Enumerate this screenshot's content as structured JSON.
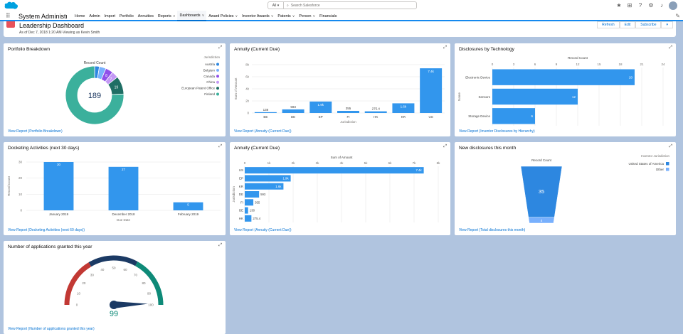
{
  "global": {
    "search_scope": "All",
    "search_placeholder": "Search Salesforce",
    "app_name": "System Administra...",
    "nav": [
      {
        "label": "Home",
        "menu": false,
        "active": false
      },
      {
        "label": "Admin",
        "menu": false,
        "active": false
      },
      {
        "label": "Import",
        "menu": false,
        "active": false
      },
      {
        "label": "Portfolio",
        "menu": false,
        "active": false
      },
      {
        "label": "Annuities",
        "menu": false,
        "active": false
      },
      {
        "label": "Reports",
        "menu": true,
        "active": false
      },
      {
        "label": "Dashboards",
        "menu": true,
        "active": true
      },
      {
        "label": "Award Policies",
        "menu": true,
        "active": false
      },
      {
        "label": "Inventor Awards",
        "menu": true,
        "active": false
      },
      {
        "label": "Patents",
        "menu": true,
        "active": false
      },
      {
        "label": "Person",
        "menu": true,
        "active": false
      },
      {
        "label": "Financials",
        "menu": false,
        "active": false
      }
    ]
  },
  "header": {
    "title": "Leadership Dashboard",
    "subtitle": "As of Dec 7, 2018 1:20 AM·Viewing as Kevin Smith",
    "buttons": [
      "Refresh",
      "Edit",
      "Subscribe"
    ]
  },
  "colors": {
    "blue": "#3296ed",
    "teal": "#2eaaa0",
    "purple": "#c398f5",
    "dark_purple": "#9050e9",
    "light_blue": "#78b0fd",
    "green_teal": "#3bb09c",
    "gauge_red": "#c23934",
    "gauge_navy": "#1b3a64",
    "gauge_teal": "#0e8a78"
  },
  "widgets": {
    "portfolio": {
      "title": "Portfolio Breakdown",
      "link": "View Report (Portfolio Breakdown)",
      "center_value": "189"
    },
    "annuity_col": {
      "title": "Annuity (Current Due)",
      "link": "View Report (Annuity (Current Due))"
    },
    "disclosures_tech": {
      "title": "Disclosures by Technology",
      "link": "View Report (Inventor Disclosures by Hierarchy)"
    },
    "docketing": {
      "title": "Docketing Activities (next 30 days)",
      "link": "View Report (Docketing Activities (next 60 days))"
    },
    "annuity_bar": {
      "title": "Annuity (Current Due)",
      "link": "View Report (Annuity (Current Due))"
    },
    "new_disclosures": {
      "title": "New disclosures this month",
      "link": "View Report (Total disclosures this month)"
    },
    "applications": {
      "title": "Number of applications granted this year",
      "link": "View Report (Number of applications granted this year)"
    }
  },
  "chart_data": [
    {
      "type": "pie",
      "id": "portfolio",
      "title": "Record Count",
      "legend_title": "Jurisdiction",
      "legend_position": "right",
      "center_value": 189,
      "categories": [
        "Austria",
        "Belgium",
        "Canada",
        "China",
        "European Patent Office",
        "Finland"
      ],
      "colors": [
        "#2d87e0",
        "#78b0fd",
        "#9050e9",
        "#c398f5",
        "#1f6e64",
        "#3bb09c"
      ],
      "values": [
        5,
        7,
        8,
        7,
        19,
        143
      ],
      "data_labels": [
        "",
        "",
        "8",
        "7",
        "19",
        ""
      ]
    },
    {
      "type": "bar",
      "id": "annuity_col",
      "xlabel": "Jurisdiction",
      "ylabel": "Sum of Amount",
      "categories": [
        "BE",
        "DE",
        "EP",
        "FI",
        "HK",
        "KR",
        "US"
      ],
      "values": [
        138,
        593,
        1900,
        355,
        275.4,
        1600,
        7400
      ],
      "data_labels": [
        "138",
        "593",
        "1.9k",
        "355",
        "275.4",
        "1.6k",
        "7.4k"
      ],
      "ylim": [
        0,
        8000
      ],
      "yticks": [
        0,
        2000,
        4000,
        6000,
        8000
      ],
      "ytick_labels": [
        "0",
        "2k",
        "4k",
        "6k",
        "8k"
      ]
    },
    {
      "type": "bar",
      "id": "disclosures_tech",
      "orientation": "horizontal",
      "title": "Record Count",
      "ylabel": "Name",
      "categories": [
        "Electronic Device",
        "Sensors",
        "Storage Device"
      ],
      "values": [
        20,
        12,
        6
      ],
      "xlim": [
        0,
        24
      ],
      "xticks": [
        0,
        3,
        6,
        9,
        12,
        15,
        18,
        21,
        24
      ]
    },
    {
      "type": "bar",
      "id": "docketing",
      "xlabel": "Due Date",
      "ylabel": "Record Count",
      "categories": [
        "January 2019",
        "December 2018",
        "February 2019"
      ],
      "values": [
        30,
        27,
        5
      ],
      "ylim": [
        0,
        30
      ],
      "yticks": [
        0,
        10,
        20,
        30
      ]
    },
    {
      "type": "bar",
      "id": "annuity_bar",
      "orientation": "horizontal",
      "title": "Sum of Amount",
      "ylabel": "Jurisdiction",
      "categories": [
        "US",
        "EP",
        "KR",
        "DE",
        "FI",
        "BE",
        "HK"
      ],
      "values": [
        7400,
        1900,
        1600,
        593,
        355,
        138,
        275.4
      ],
      "data_labels": [
        "7.4k",
        "1.9k",
        "1.6k",
        "593",
        "355",
        "138",
        "275.4"
      ],
      "xlim": [
        0,
        8000
      ],
      "xticks": [
        0,
        1000,
        2000,
        3000,
        4000,
        5000,
        6000,
        7000,
        8000
      ],
      "xtick_labels": [
        "0",
        "1k",
        "2k",
        "3k",
        "4k",
        "5k",
        "6k",
        "7k",
        "8k"
      ]
    },
    {
      "type": "funnel",
      "id": "new_disclosures",
      "title": "Record Count",
      "legend_title": "Inventor Jurisdiction",
      "legend_position": "right",
      "categories": [
        "United States of America",
        "Other"
      ],
      "colors": [
        "#2d87e0",
        "#78b0fd"
      ],
      "values": [
        35,
        4
      ]
    },
    {
      "type": "gauge",
      "id": "applications",
      "value": 99,
      "min": 0,
      "max": 100,
      "ticks": [
        0,
        10,
        20,
        30,
        40,
        50,
        60,
        70,
        80,
        90,
        100
      ],
      "bands": [
        {
          "to": 33,
          "color": "#c23934"
        },
        {
          "to": 66,
          "color": "#1b3a64"
        },
        {
          "to": 100,
          "color": "#0e8a78"
        }
      ]
    }
  ]
}
